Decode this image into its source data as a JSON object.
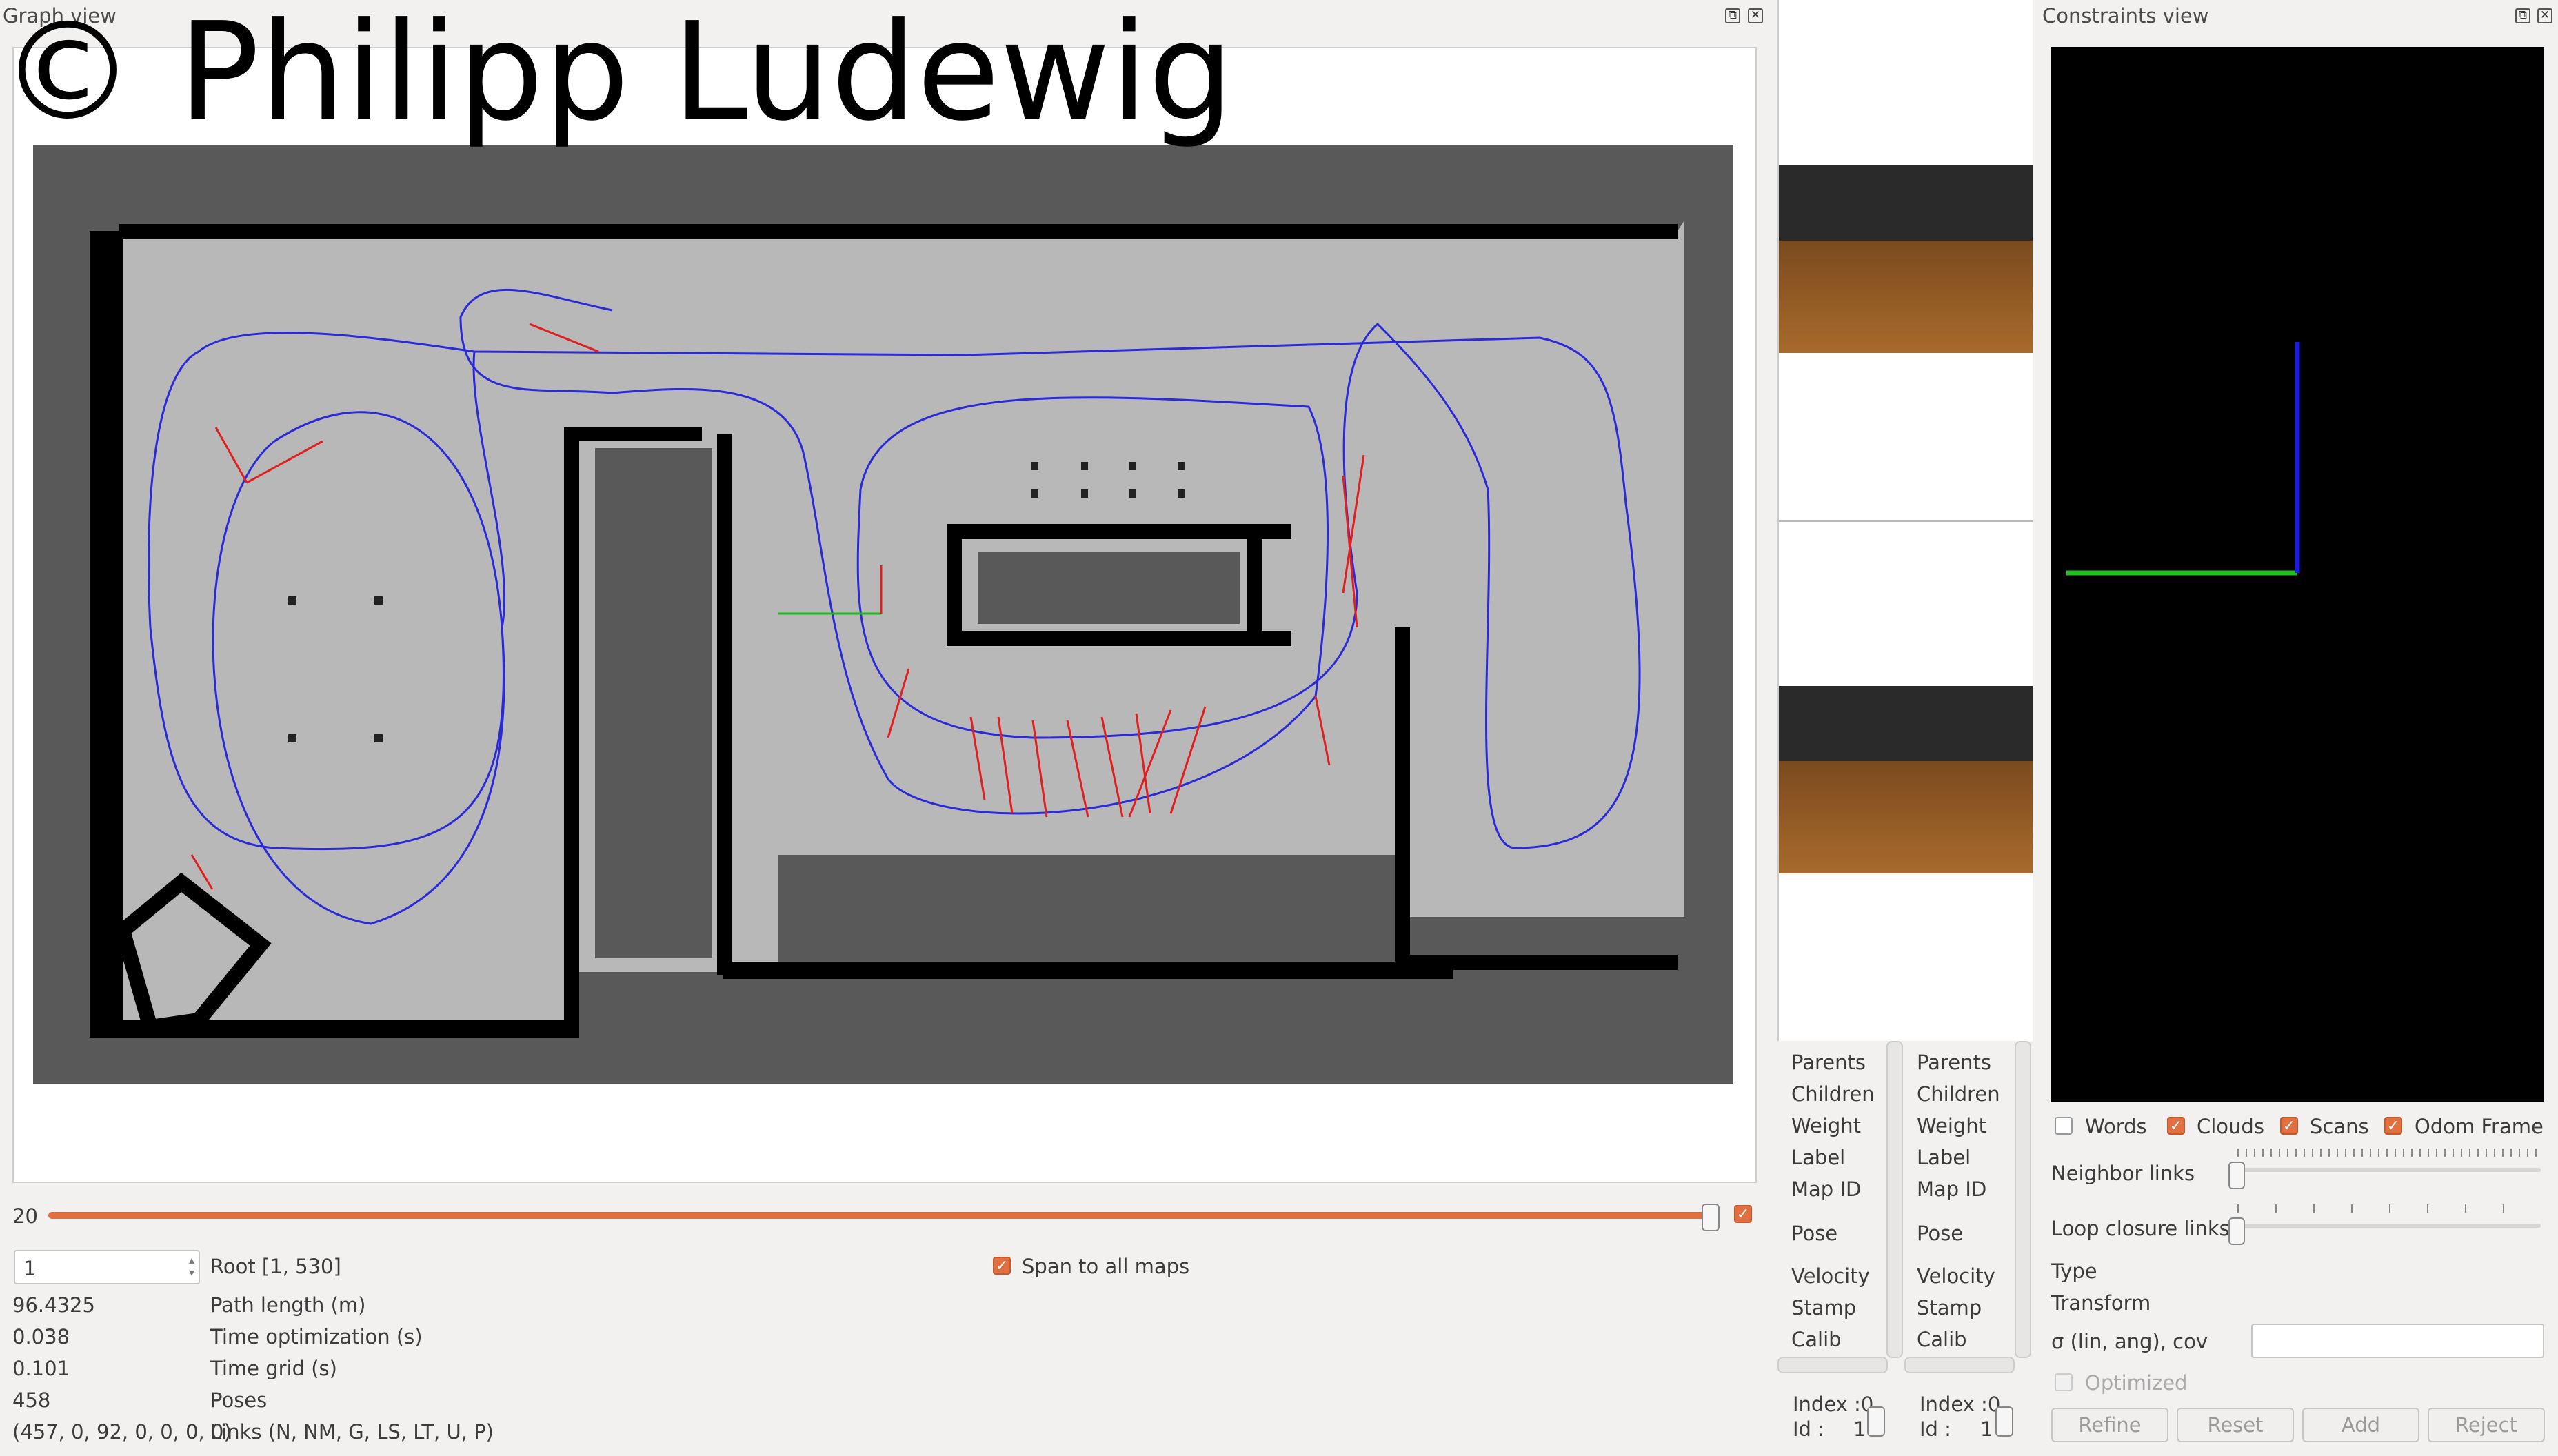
{
  "watermark": "© Philipp Ludewig",
  "graph_view": {
    "title": "Graph view",
    "slider_value": "20",
    "spin_value": "1",
    "root_label": "Root [1, 530]",
    "span_label": "Span to all maps",
    "stats": [
      {
        "value": "96.4325",
        "label": "Path length (m)"
      },
      {
        "value": "0.038",
        "label": "Time optimization (s)"
      },
      {
        "value": "0.101",
        "label": "Time grid (s)"
      },
      {
        "value": "458",
        "label": "Poses"
      },
      {
        "value": "(457, 0, 92, 0, 0, 0, 0)",
        "label": "Links (N, NM, G, LS, LT, U, P)"
      }
    ]
  },
  "node_info": {
    "fields": [
      "Parents",
      "Children",
      "Weight",
      "Label",
      "Map ID",
      "Pose",
      "Velocity",
      "Stamp",
      "Calib"
    ],
    "index_a": "Index :0",
    "id_a": "Id :",
    "id_a_val": "1",
    "index_b": "Index :0",
    "id_b": "Id :",
    "id_b_val": "1"
  },
  "constraints_view": {
    "title": "Constraints view",
    "checkboxes": [
      {
        "label": "Words",
        "checked": false
      },
      {
        "label": "Clouds",
        "checked": true
      },
      {
        "label": "Scans",
        "checked": true
      },
      {
        "label": "Odom Frame",
        "checked": true
      }
    ],
    "neighbor_links": "Neighbor links",
    "loop_closure_links": "Loop closure links",
    "type_label": "Type",
    "transform_label": "Transform",
    "sigma_label": "σ (lin, ang), cov",
    "optimized_label": "Optimized",
    "buttons": {
      "refine": "Refine",
      "reset": "Reset",
      "add": "Add",
      "reject": "Reject"
    }
  },
  "colors": {
    "accent": "#e26f3f",
    "path": "#2a2ad8",
    "loop": "#e02020"
  }
}
